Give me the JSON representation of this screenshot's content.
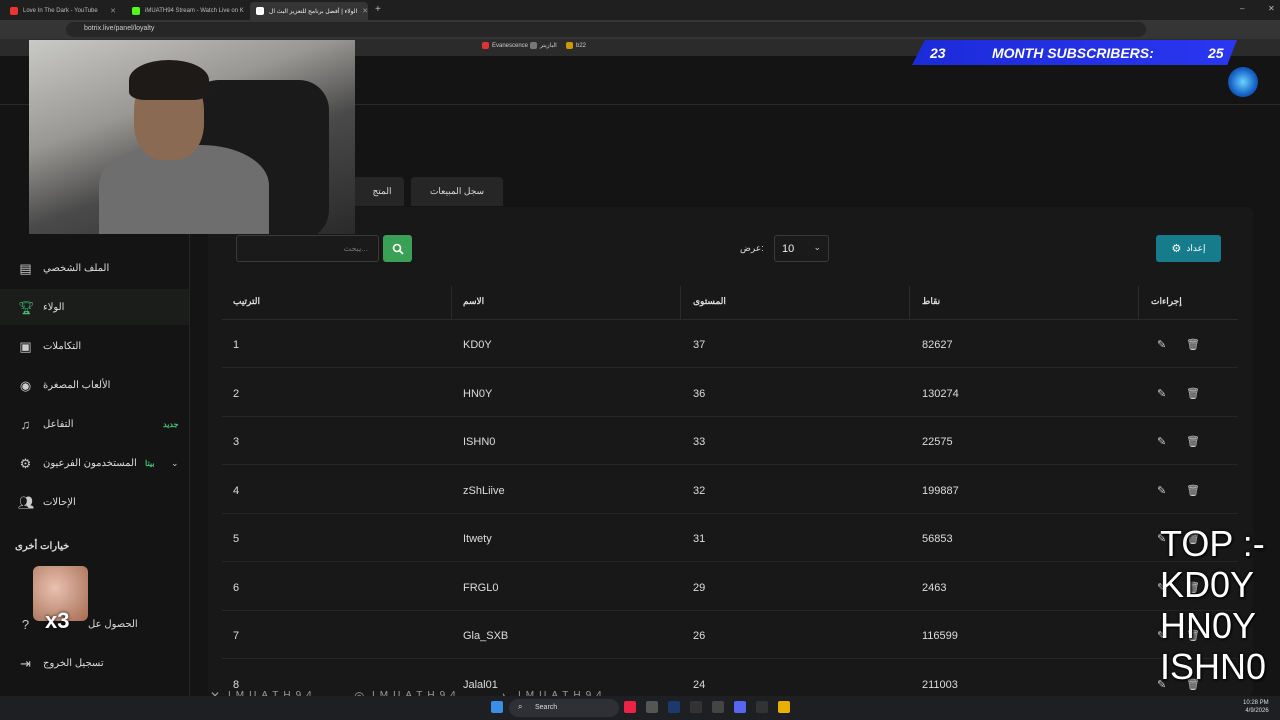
{
  "browser": {
    "tabs": [
      {
        "title": "Love In The Dark - YouTube",
        "active": false
      },
      {
        "title": "iMUATH94 Stream - Watch Live on K",
        "active": false
      },
      {
        "title": "الولاء | أفضل برنامج للتعزيز البث ال",
        "active": true
      }
    ],
    "url": "botrix.live/panel/loyalty",
    "bookmarks": [
      "Evanescence -",
      "البازيتر",
      "b22"
    ]
  },
  "sidebar": {
    "items": [
      {
        "label": "الملف الشخصي",
        "icon": "id-card-icon"
      },
      {
        "label": "الولاء",
        "icon": "trophy-icon",
        "active": true
      },
      {
        "label": "التكاملات",
        "icon": "integration-icon"
      },
      {
        "label": "الألعاب المصغرة",
        "icon": "gamepad-icon"
      },
      {
        "label": "التفاعل",
        "icon": "music-icon",
        "badge": "جديد"
      },
      {
        "label": "المستخدمون الفرعيون",
        "icon": "users-cog-icon",
        "badge": "بيتا"
      },
      {
        "label": "الإحالات",
        "icon": "users-icon"
      }
    ],
    "more_options": "خيارات أخرى",
    "bottom_items": [
      {
        "label": "الحصول عل",
        "icon": "help-icon"
      },
      {
        "label": "تسجيل الخروج",
        "icon": "logout-icon"
      }
    ]
  },
  "panel": {
    "tabs": [
      "المتج",
      "سجل المبيعات"
    ],
    "search_placeholder": "يبحث...",
    "show_label": "عرض:",
    "show_value": "10",
    "settings_label": "إعداد",
    "columns": [
      "الترتيب",
      "الاسم",
      "المستوى",
      "نقاط",
      "إجراءات"
    ],
    "rows": [
      {
        "rank": "1",
        "name": "KD0Y",
        "level": "37",
        "points": "82627"
      },
      {
        "rank": "2",
        "name": "HN0Y",
        "level": "36",
        "points": "130274"
      },
      {
        "rank": "3",
        "name": "ISHN0",
        "level": "33",
        "points": "22575"
      },
      {
        "rank": "4",
        "name": "zShLiive",
        "level": "32",
        "points": "199887"
      },
      {
        "rank": "5",
        "name": "Itwety",
        "level": "31",
        "points": "56853"
      },
      {
        "rank": "6",
        "name": "FRGL0",
        "level": "29",
        "points": "2463"
      },
      {
        "rank": "7",
        "name": "Gla_SXB",
        "level": "26",
        "points": "116599"
      },
      {
        "rank": "8",
        "name": "Jalal01",
        "level": "24",
        "points": "211003"
      }
    ]
  },
  "overlay": {
    "banner_left": "23",
    "banner_mid": "MONTH SUBSCRIBERS:",
    "banner_right": "25",
    "top_title": "TOP :-",
    "top_names": [
      "KD0Y",
      "HN0Y",
      "ISHN0"
    ],
    "sticker_text": "x3",
    "social_text": "IMUATH94"
  },
  "taskbar": {
    "search_label": "Search",
    "time": "10:28 PM",
    "date": "4/9/2026"
  },
  "colors": {
    "accent_green": "#3aa055",
    "settings_blue": "#167c8c",
    "badge_green": "#3fc17a",
    "banner_blue": "#1c2bd9"
  }
}
